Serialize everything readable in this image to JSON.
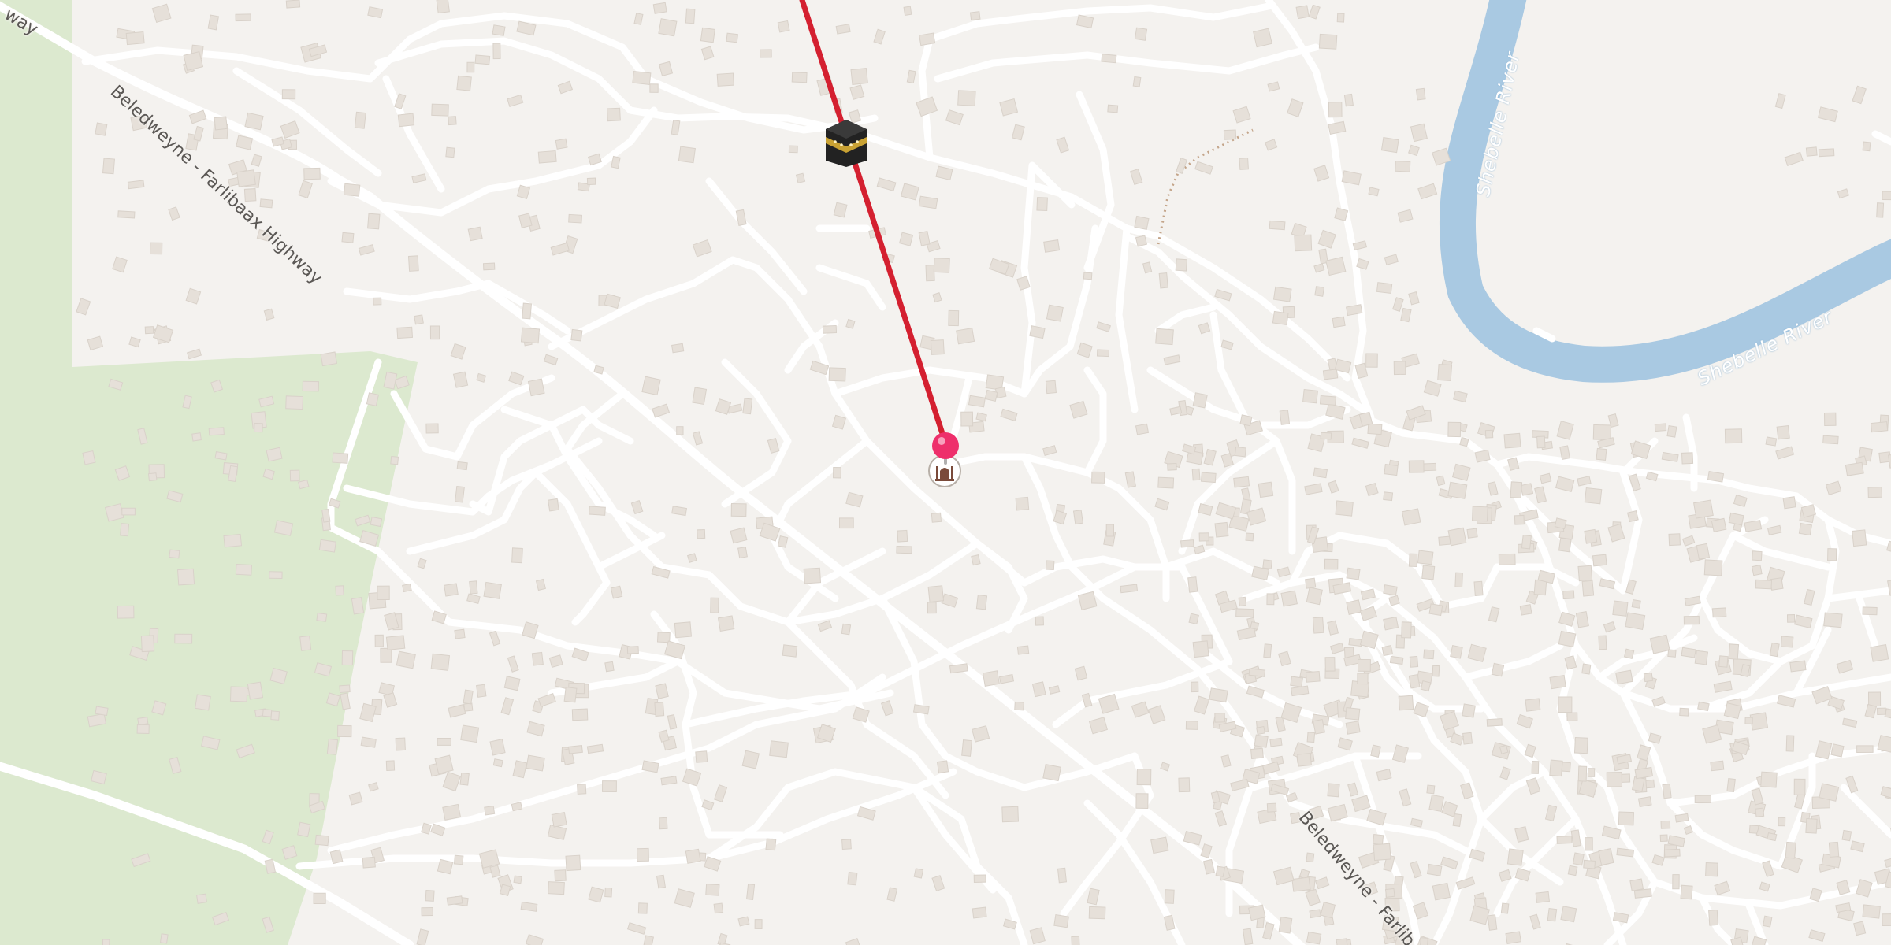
{
  "map": {
    "colors": {
      "background": "#f4f2ef",
      "park": "#dce9cf",
      "water": "#a9c9e2",
      "road": "#ffffff",
      "building": "#e6e0d9",
      "route": "#d42030",
      "pin": "#ee2f6b",
      "footpath": "#c4a58a"
    },
    "labels": {
      "highway_top_left_fragment": "way",
      "highway_diagonal": "Beledweyne - Farlibaax Highway",
      "highway_bottom": "Beledweyne - Farlib",
      "river_vertical": "Shebelle River",
      "river_horizontal": "Shebelle River"
    },
    "icons": {
      "kaaba": "kaaba-icon",
      "mosque": "mosque-icon",
      "pin": "location-pin-icon"
    }
  }
}
